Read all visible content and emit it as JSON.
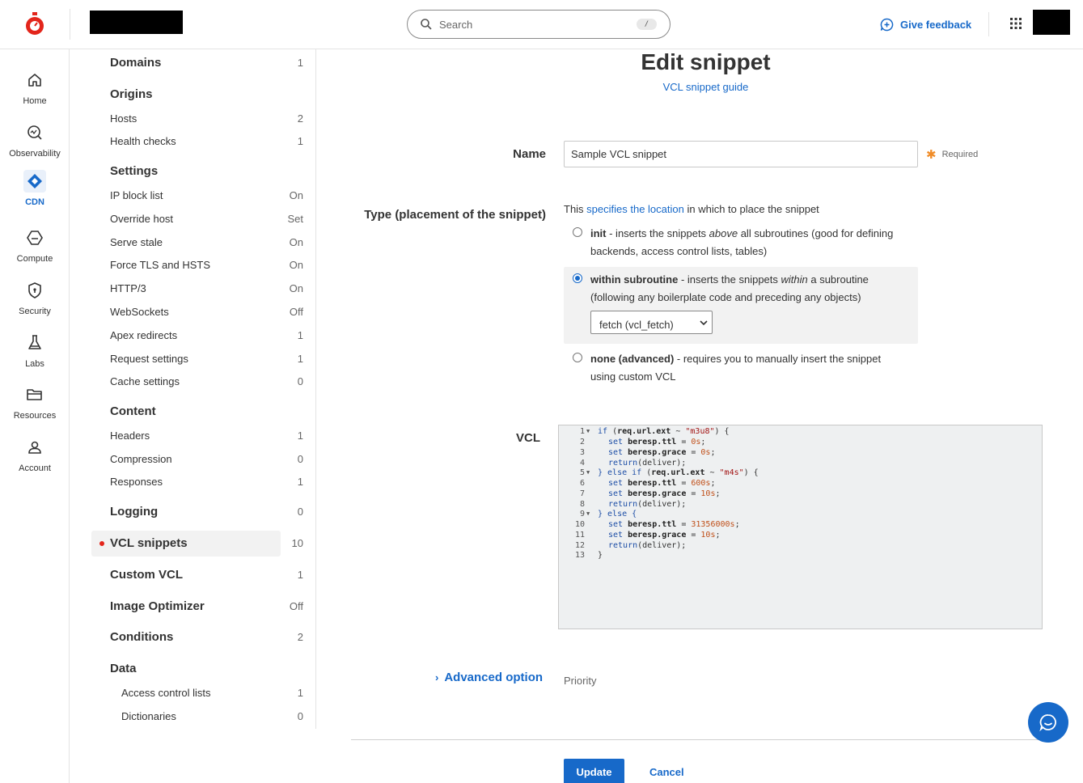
{
  "header": {
    "search_placeholder": "Search",
    "search_shortcut": "/",
    "feedback_label": "Give feedback"
  },
  "rail": {
    "items": [
      {
        "label": "Home",
        "icon": "home-icon"
      },
      {
        "label": "Observability",
        "icon": "observability-icon"
      },
      {
        "label": "CDN",
        "icon": "cdn-icon",
        "active": true
      },
      {
        "label": "Compute",
        "icon": "compute-icon"
      },
      {
        "label": "Security",
        "icon": "shield-icon"
      },
      {
        "label": "Labs",
        "icon": "flask-icon"
      },
      {
        "label": "Resources",
        "icon": "folder-icon"
      },
      {
        "label": "Account",
        "icon": "person-icon"
      }
    ]
  },
  "nav": {
    "domains": {
      "label": "Domains",
      "value": "1"
    },
    "origins": {
      "label": "Origins"
    },
    "hosts": {
      "label": "Hosts",
      "value": "2"
    },
    "health_checks": {
      "label": "Health checks",
      "value": "1"
    },
    "settings": {
      "label": "Settings"
    },
    "ip_block_list": {
      "label": "IP block list",
      "value": "On"
    },
    "override_host": {
      "label": "Override host",
      "value": "Set"
    },
    "serve_stale": {
      "label": "Serve stale",
      "value": "On"
    },
    "force_tls": {
      "label": "Force TLS and HSTS",
      "value": "On"
    },
    "http3": {
      "label": "HTTP/3",
      "value": "On"
    },
    "websockets": {
      "label": "WebSockets",
      "value": "Off"
    },
    "apex_redirects": {
      "label": "Apex redirects",
      "value": "1"
    },
    "request_settings": {
      "label": "Request settings",
      "value": "1"
    },
    "cache_settings": {
      "label": "Cache settings",
      "value": "0"
    },
    "content": {
      "label": "Content"
    },
    "headers": {
      "label": "Headers",
      "value": "1"
    },
    "compression": {
      "label": "Compression",
      "value": "0"
    },
    "responses": {
      "label": "Responses",
      "value": "1"
    },
    "logging": {
      "label": "Logging",
      "value": "0"
    },
    "vcl_snippets": {
      "label": "VCL snippets",
      "value": "10"
    },
    "custom_vcl": {
      "label": "Custom VCL",
      "value": "1"
    },
    "image_optimizer": {
      "label": "Image Optimizer",
      "value": "Off"
    },
    "conditions": {
      "label": "Conditions",
      "value": "2"
    },
    "data": {
      "label": "Data"
    },
    "acl": {
      "label": "Access control lists",
      "value": "1"
    },
    "dictionaries": {
      "label": "Dictionaries",
      "value": "0"
    }
  },
  "form": {
    "title": "Edit snippet",
    "guide_link": "VCL snippet guide",
    "name_label": "Name",
    "name_value": "Sample VCL snippet",
    "required_label": "Required",
    "type_label": "Type (placement of the snippet)",
    "type_intro_pre": "This ",
    "type_intro_link": "specifies the location",
    "type_intro_post": " in which to place the snippet",
    "options": {
      "init": {
        "title": "init",
        "pre": " - inserts the snippets ",
        "em": "above",
        "post": " all subroutines (good for defining backends, access control lists, tables)"
      },
      "within": {
        "title": "within subroutine",
        "pre": " - inserts the snippets ",
        "em": "within",
        "post": " a subroutine (following any boilerplate code and preceding any objects)"
      },
      "none": {
        "title": "none (advanced)",
        "pre": " - requires you to manually insert the snippet using custom VCL"
      }
    },
    "subroutine_select": "fetch (vcl_fetch)",
    "vcl_label": "VCL",
    "advanced_label": "Advanced option",
    "priority_label": "Priority",
    "update_label": "Update",
    "cancel_label": "Cancel"
  },
  "vcl_lines": [
    {
      "n": "1",
      "fold": true
    },
    {
      "n": "2"
    },
    {
      "n": "3"
    },
    {
      "n": "4"
    },
    {
      "n": "5",
      "fold": true
    },
    {
      "n": "6"
    },
    {
      "n": "7"
    },
    {
      "n": "8"
    },
    {
      "n": "9",
      "fold": true
    },
    {
      "n": "10"
    },
    {
      "n": "11"
    },
    {
      "n": "12"
    },
    {
      "n": "13"
    }
  ],
  "vcl_tokens": {
    "if": "if",
    "set": "set",
    "return": "return",
    "ext": "req.url.ext",
    "ttl": "beresp.ttl",
    "grace": "beresp.grace",
    "m3u8": "\"m3u8\"",
    "m4s": "\"m4s\"",
    "zero": "0s",
    "s600": "600s",
    "s10": "10s",
    "s31": "31356000s",
    "else_if": "} else if",
    "else": "} else {",
    "close": "}",
    "deliver": "(deliver);",
    "tilde": " ~ ",
    "open": ") {",
    "lparen": " (",
    "eq": " = ",
    "semi": ";"
  }
}
